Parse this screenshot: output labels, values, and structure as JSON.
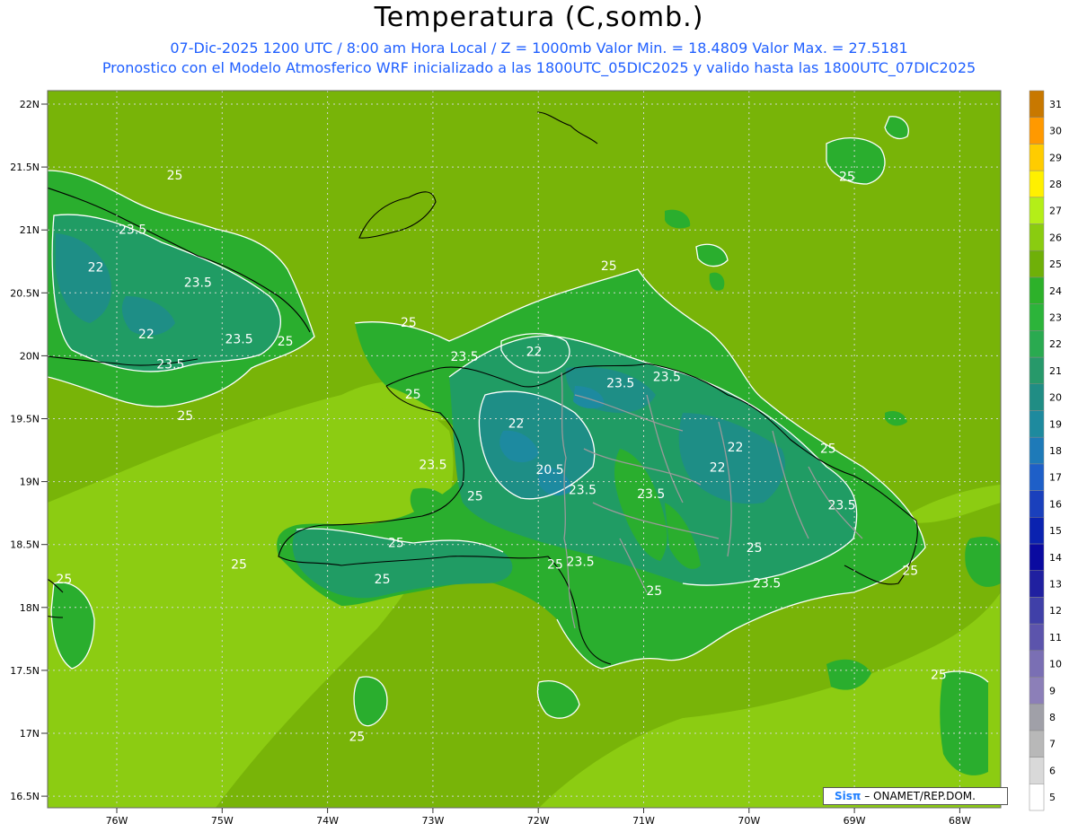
{
  "header": {
    "title": "Temperatura (C,somb.)",
    "subtitle_1": "07-Dic-2025  1200 UTC / 8:00 am Hora Local / Z = 1000mb   Valor Min. = 18.4809  Valor Max. = 27.5181",
    "subtitle_2": "Pronostico con el Modelo Atmosferico WRF inicializado a las 1800UTC_05DIC2025 y valido hasta las  1800UTC_07DIC2025"
  },
  "axes": {
    "lat_labels": [
      "22N",
      "21.5N",
      "21N",
      "20.5N",
      "20N",
      "19.5N",
      "19N",
      "18.5N",
      "18N",
      "17.5N",
      "17N",
      "16.5N"
    ],
    "lon_labels": [
      "76W",
      "75W",
      "74W",
      "73W",
      "72W",
      "71W",
      "70W",
      "69W",
      "68W"
    ]
  },
  "colorbar": {
    "levels": [
      "5",
      "6",
      "7",
      "8",
      "9",
      "10",
      "11",
      "12",
      "13",
      "14",
      "15",
      "16",
      "17",
      "18",
      "19",
      "20",
      "21",
      "22",
      "23",
      "24",
      "25",
      "26",
      "27",
      "28",
      "29",
      "30",
      "31"
    ],
    "colors": [
      "#ffffff",
      "#d9d9d9",
      "#b8b8b8",
      "#a0a0a8",
      "#8c7fb8",
      "#7a6fb4",
      "#5c54ac",
      "#4040a8",
      "#2020a0",
      "#0a0aa0",
      "#0a22b0",
      "#1a40bc",
      "#1e5fc8",
      "#1e7ab8",
      "#1e8a9e",
      "#208d84",
      "#27996a",
      "#2aaa50",
      "#2cb43a",
      "#2db12a",
      "#6fb008",
      "#8acc10",
      "#b4ee18",
      "#fff000",
      "#ffcc00",
      "#ff9900",
      "#c87800"
    ]
  },
  "colors": {
    "sea": "#78b408",
    "sea_warm": "#8ccc12",
    "land_25": "#2aae2e",
    "land_23": "#209c64",
    "land_22": "#1e8e86",
    "land_21": "#1d8aa0"
  },
  "contour_labels": [
    {
      "text": "25",
      "lon": -75.45,
      "lat": 21.4
    },
    {
      "text": "23.5",
      "lon": -75.85,
      "lat": 20.97
    },
    {
      "text": "22",
      "lon": -76.2,
      "lat": 20.67
    },
    {
      "text": "23.5",
      "lon": -75.23,
      "lat": 20.55
    },
    {
      "text": "22",
      "lon": -75.72,
      "lat": 20.14
    },
    {
      "text": "23.5",
      "lon": -74.84,
      "lat": 20.1
    },
    {
      "text": "25",
      "lon": -74.4,
      "lat": 20.08
    },
    {
      "text": "23.5",
      "lon": -75.49,
      "lat": 19.9
    },
    {
      "text": "25",
      "lon": -75.35,
      "lat": 19.49
    },
    {
      "text": "25",
      "lon": -73.23,
      "lat": 20.23
    },
    {
      "text": "25",
      "lon": -73.19,
      "lat": 19.66
    },
    {
      "text": "23.5",
      "lon": -72.7,
      "lat": 19.96
    },
    {
      "text": "22",
      "lon": -72.04,
      "lat": 20.0
    },
    {
      "text": "25",
      "lon": -71.33,
      "lat": 20.68
    },
    {
      "text": "23.5",
      "lon": -71.22,
      "lat": 19.75
    },
    {
      "text": "23.5",
      "lon": -70.78,
      "lat": 19.8
    },
    {
      "text": "22",
      "lon": -72.21,
      "lat": 19.43
    },
    {
      "text": "22",
      "lon": -70.13,
      "lat": 19.24
    },
    {
      "text": "22",
      "lon": -70.3,
      "lat": 19.08
    },
    {
      "text": "25",
      "lon": -69.25,
      "lat": 19.23
    },
    {
      "text": "23.5",
      "lon": -73.0,
      "lat": 19.1
    },
    {
      "text": "20.5",
      "lon": -71.89,
      "lat": 19.06
    },
    {
      "text": "23.5",
      "lon": -71.58,
      "lat": 18.9
    },
    {
      "text": "23.5",
      "lon": -70.93,
      "lat": 18.87
    },
    {
      "text": "23.5",
      "lon": -69.12,
      "lat": 18.78
    },
    {
      "text": "25",
      "lon": -72.6,
      "lat": 18.85
    },
    {
      "text": "25",
      "lon": -73.35,
      "lat": 18.48
    },
    {
      "text": "25",
      "lon": -74.84,
      "lat": 18.31
    },
    {
      "text": "25",
      "lon": -73.48,
      "lat": 18.19
    },
    {
      "text": "25",
      "lon": -71.84,
      "lat": 18.31
    },
    {
      "text": "23.5",
      "lon": -71.6,
      "lat": 18.33
    },
    {
      "text": "25",
      "lon": -69.95,
      "lat": 18.44
    },
    {
      "text": "25",
      "lon": -68.47,
      "lat": 18.26
    },
    {
      "text": "23.5",
      "lon": -69.83,
      "lat": 18.16
    },
    {
      "text": "25",
      "lon": -70.9,
      "lat": 18.1
    },
    {
      "text": "25",
      "lon": -76.5,
      "lat": 18.19
    },
    {
      "text": "25",
      "lon": -73.72,
      "lat": 16.94
    },
    {
      "text": "25",
      "lon": -69.07,
      "lat": 21.39
    },
    {
      "text": "25",
      "lon": -68.2,
      "lat": 17.43
    }
  ],
  "footer": {
    "brand": "Sisπ",
    "credit": "– ONAMET/REP.DOM."
  }
}
